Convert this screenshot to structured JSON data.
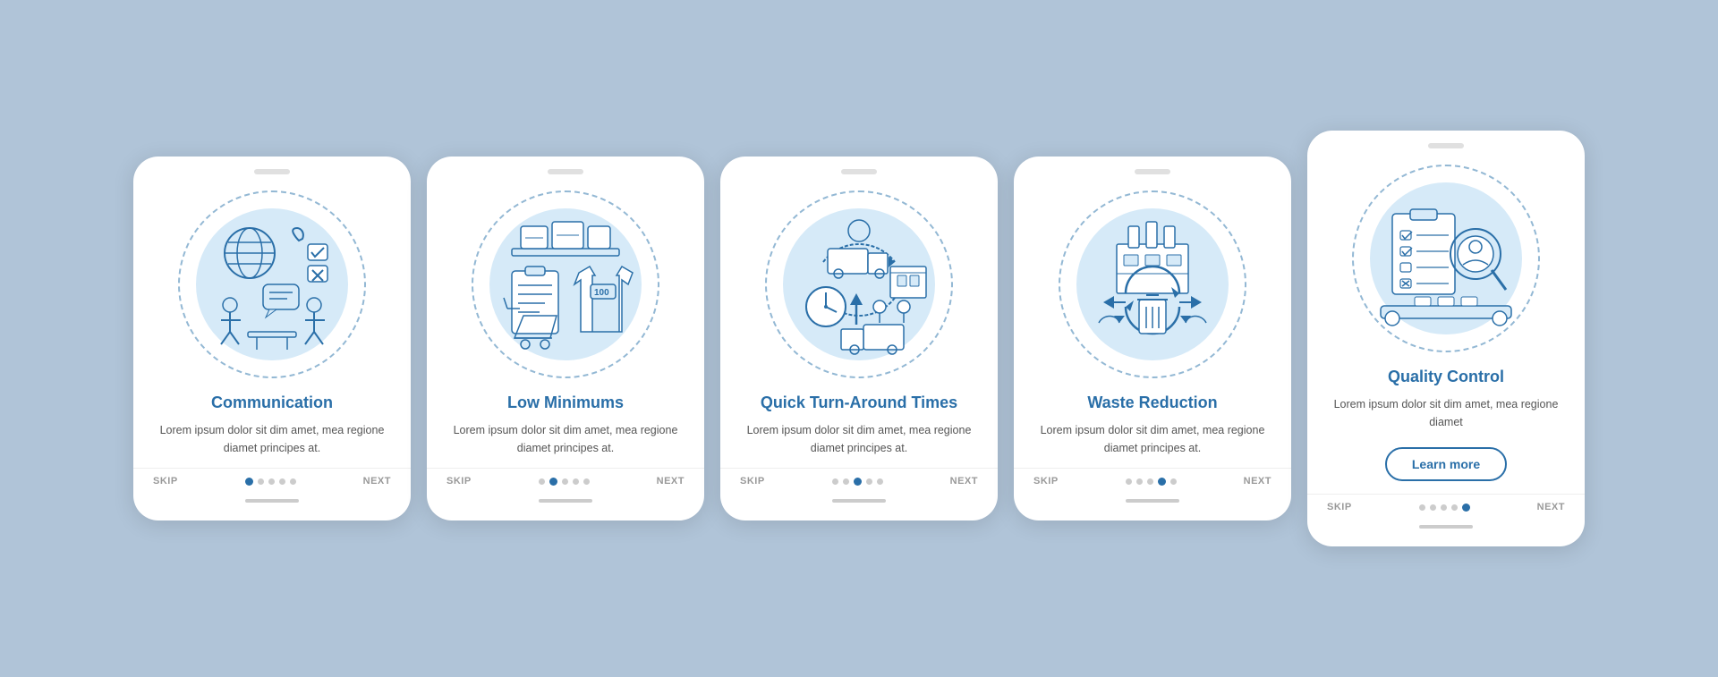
{
  "cards": [
    {
      "id": "communication",
      "title": "Communication",
      "body": "Lorem ipsum dolor sit dim amet, mea regione diamet principes at.",
      "skip": "SKIP",
      "next": "NEXT",
      "activeDot": 0,
      "totalDots": 5,
      "showLearnMore": false
    },
    {
      "id": "low-minimums",
      "title": "Low Minimums",
      "body": "Lorem ipsum dolor sit dim amet, mea regione diamet principes at.",
      "skip": "SKIP",
      "next": "NEXT",
      "activeDot": 1,
      "totalDots": 5,
      "showLearnMore": false
    },
    {
      "id": "quick-turnaround",
      "title": "Quick Turn-Around Times",
      "body": "Lorem ipsum dolor sit dim amet, mea regione diamet principes at.",
      "skip": "SKIP",
      "next": "NEXT",
      "activeDot": 2,
      "totalDots": 5,
      "showLearnMore": false
    },
    {
      "id": "waste-reduction",
      "title": "Waste Reduction",
      "body": "Lorem ipsum dolor sit dim amet, mea regione diamet principes at.",
      "skip": "SKIP",
      "next": "NEXT",
      "activeDot": 3,
      "totalDots": 5,
      "showLearnMore": false
    },
    {
      "id": "quality-control",
      "title": "Quality Control",
      "body": "Lorem ipsum dolor sit dim amet, mea regione diamet",
      "skip": "SKIP",
      "next": "NEXT",
      "activeDot": 4,
      "totalDots": 5,
      "showLearnMore": true,
      "learnMoreLabel": "Learn more"
    }
  ],
  "colors": {
    "accent": "#2a6fa8",
    "lightBlue": "#d6eaf8",
    "dashedCircle": "#93b8d4"
  }
}
